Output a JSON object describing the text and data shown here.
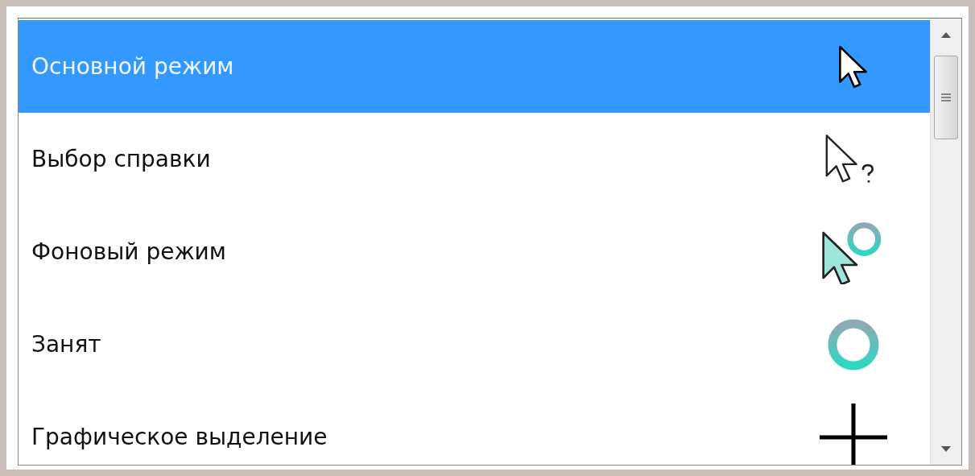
{
  "cursor_list": {
    "items": [
      {
        "label": "Основной режим",
        "kind": "arrow",
        "selected": true
      },
      {
        "label": "Выбор справки",
        "kind": "help",
        "selected": false
      },
      {
        "label": "Фоновый режим",
        "kind": "working",
        "selected": false
      },
      {
        "label": "Занят",
        "kind": "busy",
        "selected": false
      },
      {
        "label": "Графическое выделение",
        "kind": "cross",
        "selected": false
      }
    ]
  }
}
